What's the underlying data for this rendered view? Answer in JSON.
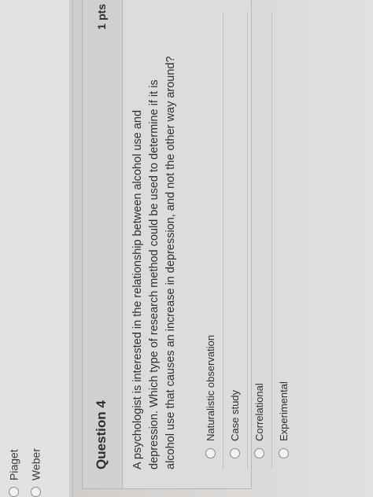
{
  "previous_question": {
    "options": [
      {
        "label": "Piaget"
      },
      {
        "label": "Weber"
      }
    ]
  },
  "question": {
    "title": "Question 4",
    "points": "1 pts",
    "text": "A psychologist is interested in the relationship between alcohol use and depression. Which type of research method could be used to determine if it is alcohol use that causes an increase in depression, and not the other way around?",
    "options": [
      {
        "label": "Naturalistic observation"
      },
      {
        "label": "Case study"
      },
      {
        "label": "Correlational"
      },
      {
        "label": "Experimental"
      }
    ]
  },
  "icons": {
    "flag": "bookmark-flag-icon",
    "cursor": "mouse-pointer-icon"
  }
}
